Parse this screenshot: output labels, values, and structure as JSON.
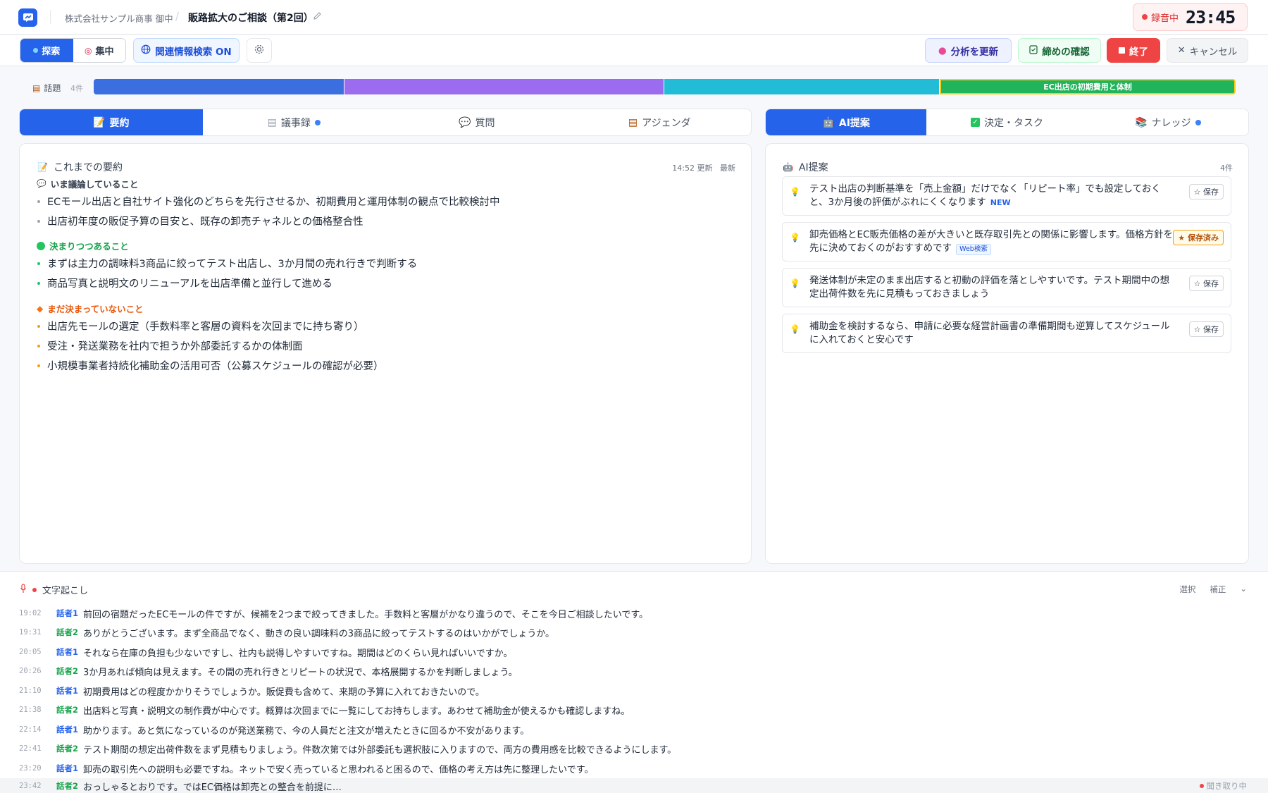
{
  "header": {
    "client": "株式会社サンプル商事 御中",
    "separator": "/",
    "meeting_title": "販路拡大のご相談（第2回）",
    "recording_label": "録音中",
    "timer": "23:45"
  },
  "toolbar": {
    "mode_explore": "探索",
    "mode_focus": "集中",
    "related_search": "関連情報検索 ON",
    "refresh_analysis": "分析を更新",
    "confirm_closing": "締めの確認",
    "end": "終了",
    "cancel": "キャンセル"
  },
  "topics": {
    "label": "話題",
    "count": "4件",
    "active_label": "EC出店の初期費用と体制",
    "colors": [
      "#3b6fe0",
      "#9b6cf0",
      "#22bcd6",
      "#22b45c"
    ]
  },
  "left_tabs": [
    "要約",
    "議事録",
    "質問",
    "アジェンダ"
  ],
  "right_tabs": [
    "AI提案",
    "決定・タスク",
    "ナレッジ"
  ],
  "summary": {
    "title": "これまでの要約",
    "updated": "14:52 更新",
    "latest": "最新",
    "sections": [
      {
        "heading": "いま議論していること",
        "color": "#374151",
        "items": [
          "ECモール出店と自社サイト強化のどちらを先行させるか、初期費用と運用体制の観点で比較検討中",
          "出店初年度の販促予算の目安と、既存の卸売チャネルとの価格整合性"
        ]
      },
      {
        "heading": "決まりつつあること",
        "color": "#16a34a",
        "items": [
          "まずは主力の調味料3商品に絞ってテスト出店し、3か月間の売れ行きで判断する",
          "商品写真と説明文のリニューアルを出店準備と並行して進める"
        ]
      },
      {
        "heading": "まだ決まっていないこと",
        "color": "#ea580c",
        "items": [
          "出店先モールの選定（手数料率と客層の資料を次回までに持ち寄り）",
          "受注・発送業務を社内で担うか外部委託するかの体制面",
          "小規模事業者持続化補助金の活用可否（公募スケジュールの確認が必要）"
        ]
      }
    ]
  },
  "ai": {
    "title": "AI提案",
    "count": "4件",
    "new_badge": "NEW",
    "web_badge": "Web検索",
    "save": "☆ 保存",
    "saved": "★ 保存済み",
    "suggestions": [
      "テスト出店の判断基準を「売上金額」だけでなく「リピート率」でも設定しておくと、3か月後の評価がぶれにくくなります",
      "卸売価格とEC販売価格の差が大きいと既存取引先との関係に影響します。価格方針を先に決めておくのがおすすめです",
      "発送体制が未定のまま出店すると初動の評価を落としやすいです。テスト期間中の想定出荷件数を先に見積もっておきましょう",
      "補助金を検討するなら、申請に必要な経営計画書の準備期間も逆算してスケジュールに入れておくと安心です"
    ]
  },
  "transcript": {
    "title": "文字起こし",
    "select": "選択",
    "correct": "補正",
    "listening": "聞き取り中",
    "rows": [
      {
        "time": "19:02",
        "speaker": "話者1",
        "text": "前回の宿題だったECモールの件ですが、候補を2つまで絞ってきました。手数料と客層がかなり違うので、そこを今日ご相談したいです。"
      },
      {
        "time": "19:31",
        "speaker": "話者2",
        "text": "ありがとうございます。まず全商品でなく、動きの良い調味料の3商品に絞ってテストするのはいかがでしょうか。"
      },
      {
        "time": "20:05",
        "speaker": "話者1",
        "text": "それなら在庫の負担も少ないですし、社内も説得しやすいですね。期間はどのくらい見ればいいですか。"
      },
      {
        "time": "20:26",
        "speaker": "話者2",
        "text": "3か月あれば傾向は見えます。その間の売れ行きとリピートの状況で、本格展開するかを判断しましょう。"
      },
      {
        "time": "21:10",
        "speaker": "話者1",
        "text": "初期費用はどの程度かかりそうでしょうか。販促費も含めて、来期の予算に入れておきたいので。"
      },
      {
        "time": "21:38",
        "speaker": "話者2",
        "text": "出店料と写真・説明文の制作費が中心です。概算は次回までに一覧にしてお持ちします。あわせて補助金が使えるかも確認しますね。"
      },
      {
        "time": "22:14",
        "speaker": "話者1",
        "text": "助かります。あと気になっているのが発送業務で、今の人員だと注文が増えたときに回るか不安があります。"
      },
      {
        "time": "22:41",
        "speaker": "話者2",
        "text": "テスト期間の想定出荷件数をまず見積もりましょう。件数次第では外部委託も選択肢に入りますので、両方の費用感を比較できるようにします。"
      },
      {
        "time": "23:20",
        "speaker": "話者1",
        "text": "卸売の取引先への説明も必要ですね。ネットで安く売っていると思われると困るので、価格の考え方は先に整理したいです。"
      },
      {
        "time": "23:42",
        "speaker": "話者2",
        "text": "おっしゃるとおりです。ではEC価格は卸売との整合を前提に…"
      }
    ]
  }
}
